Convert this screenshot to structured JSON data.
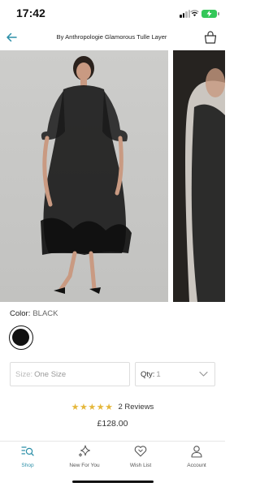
{
  "status": {
    "time": "17:42"
  },
  "nav": {
    "title": "By Anthropologie Glamorous Tulle Layer"
  },
  "colors": {
    "accent": "#2c8fa8",
    "star": "#e5b73b",
    "swatch": "#111111"
  },
  "color_option": {
    "label": "Color:",
    "value": "BLACK"
  },
  "size": {
    "label": "Size:",
    "value": "One Size"
  },
  "quantity": {
    "label": "Qty:",
    "value": "1"
  },
  "reviews": {
    "stars": "★★★★★",
    "rating": 5,
    "count_label": "2 Reviews"
  },
  "price": "£128.00",
  "tabs": [
    {
      "label": "Shop",
      "icon": "shop-search-icon",
      "active": true
    },
    {
      "label": "New For You",
      "icon": "sparkle-icon",
      "active": false
    },
    {
      "label": "Wish List",
      "icon": "heart-icon",
      "active": false
    },
    {
      "label": "Account",
      "icon": "person-icon",
      "active": false
    }
  ]
}
